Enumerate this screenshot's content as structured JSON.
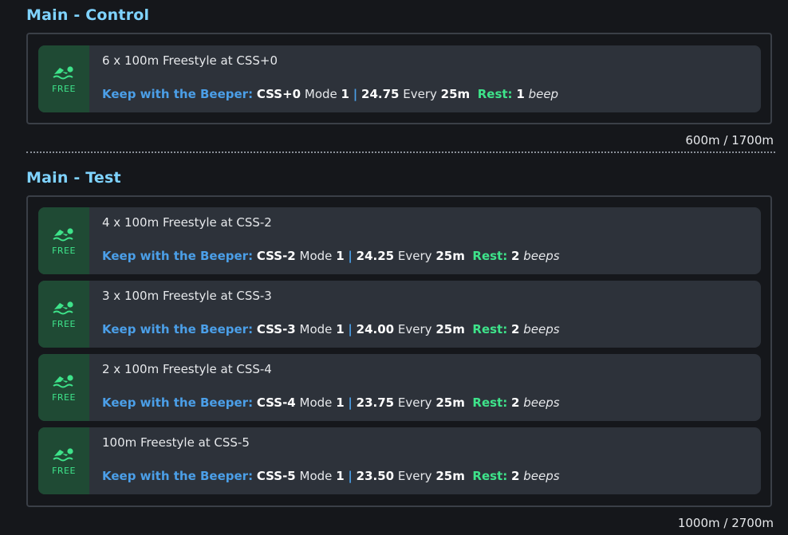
{
  "sections": [
    {
      "title": "Main - Control",
      "total": "600m / 1700m",
      "rows": [
        {
          "badge": "FREE",
          "title": "6 x 100m Freestyle at CSS+0",
          "beeper_label": "Keep with the Beeper:",
          "css": "CSS+0",
          "mode_label": "Mode",
          "mode": "1",
          "sep": "|",
          "pace": "24.75",
          "every_label": "Every",
          "every": "25m",
          "rest_label": "Rest:",
          "rest": "1",
          "rest_unit": "beep"
        }
      ]
    },
    {
      "title": "Main - Test",
      "total": "1000m / 2700m",
      "rows": [
        {
          "badge": "FREE",
          "title": "4 x 100m Freestyle at CSS-2",
          "beeper_label": "Keep with the Beeper:",
          "css": "CSS-2",
          "mode_label": "Mode",
          "mode": "1",
          "sep": "|",
          "pace": "24.25",
          "every_label": "Every",
          "every": "25m",
          "rest_label": "Rest:",
          "rest": "2",
          "rest_unit": "beeps"
        },
        {
          "badge": "FREE",
          "title": "3 x 100m Freestyle at CSS-3",
          "beeper_label": "Keep with the Beeper:",
          "css": "CSS-3",
          "mode_label": "Mode",
          "mode": "1",
          "sep": "|",
          "pace": "24.00",
          "every_label": "Every",
          "every": "25m",
          "rest_label": "Rest:",
          "rest": "2",
          "rest_unit": "beeps"
        },
        {
          "badge": "FREE",
          "title": "2 x 100m Freestyle at CSS-4",
          "beeper_label": "Keep with the Beeper:",
          "css": "CSS-4",
          "mode_label": "Mode",
          "mode": "1",
          "sep": "|",
          "pace": "23.75",
          "every_label": "Every",
          "every": "25m",
          "rest_label": "Rest:",
          "rest": "2",
          "rest_unit": "beeps"
        },
        {
          "badge": "FREE",
          "title": "100m Freestyle at CSS-5",
          "beeper_label": "Keep with the Beeper:",
          "css": "CSS-5",
          "mode_label": "Mode",
          "mode": "1",
          "sep": "|",
          "pace": "23.50",
          "every_label": "Every",
          "every": "25m",
          "rest_label": "Rest:",
          "rest": "2",
          "rest_unit": "beeps"
        }
      ]
    }
  ],
  "icons": {
    "stroke": "swimmer-icon"
  },
  "colors": {
    "background": "#15171b",
    "section_title": "#7fd3ff",
    "row_bg": "#2d323a",
    "badge_bg": "#1f4a34",
    "badge_text": "#3ee38a",
    "beeper": "#4b9fe8",
    "rest": "#3ee38a",
    "border": "#3a3f47"
  }
}
